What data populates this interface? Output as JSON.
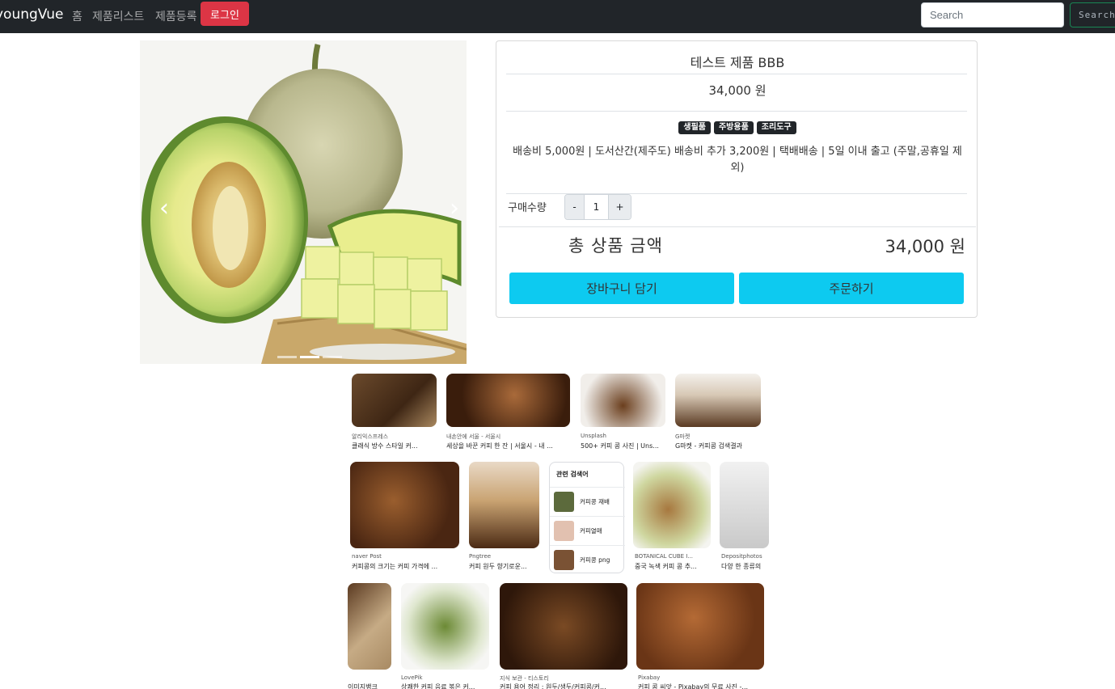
{
  "navbar": {
    "brand": "youngVue",
    "links": [
      "홈",
      "제품리스트",
      "제품등록"
    ],
    "login_label": "로그인",
    "search_placeholder": "Search",
    "search_button": "Search"
  },
  "carousel": {
    "prev_icon": "chevron-left-icon",
    "next_icon": "chevron-right-icon",
    "indicator_count": 3
  },
  "product": {
    "name": "테스트 제품 BBB",
    "price": "34,000 원",
    "tags": [
      "생필품",
      "주방용품",
      "조리도구"
    ],
    "shipping": "배송비 5,000원 | 도서산간(제주도) 배송비 추가 3,200원 | 택배배송 | 5일 이내 출고 (주말,공휴일 제외)",
    "quantity_label": "구매수량",
    "qty_minus": "-",
    "qty_value": "1",
    "qty_plus": "+",
    "total_label": "총 상품 금액",
    "total_value": "34,000 원",
    "cart_button": "장바구니 담기",
    "order_button": "주문하기"
  },
  "image_results": {
    "row1": [
      {
        "source": "알리익스프레스",
        "caption": "클래식 방수 스타일 커..."
      },
      {
        "source": "내손안에 서울 - 서울시",
        "caption": "세상을 바꾼 커피 한 잔 | 서울시 - 내 ..."
      },
      {
        "source": "Unsplash",
        "caption": "500+ 커피 콩 사진 | Uns..."
      },
      {
        "source": "G마켓",
        "caption": "G마켓 - 커피콩 검색결과"
      }
    ],
    "row2": [
      {
        "source": "naver Post",
        "caption": "커피콩의 크기는 커피 가격에 ..."
      },
      {
        "source": "Pngtree",
        "caption": "커피 원두 향기로운..."
      },
      {
        "source": "BOTANICAL CUBE I...",
        "caption": "중국 녹색 커피 콩 추..."
      },
      {
        "source": "Depositphotos",
        "caption": "다양 한 종류의"
      }
    ],
    "related": {
      "title": "관련 검색어",
      "items": [
        "커피콩 재배",
        "커피열매",
        "커피콩 png"
      ]
    },
    "row3": [
      {
        "source": "",
        "caption": "이미지뱅크"
      },
      {
        "source": "LovePik",
        "caption": "상쾌한 커피 음료 볶은 커..."
      },
      {
        "source": "지식 보관 - 티스토리",
        "caption": "커피 용어 정리 : 원두/생두/커피콩/커..."
      },
      {
        "source": "Pixabay",
        "caption": "커피 콩 씨앗 - Pixabay의 무료 사진 -..."
      }
    ]
  }
}
